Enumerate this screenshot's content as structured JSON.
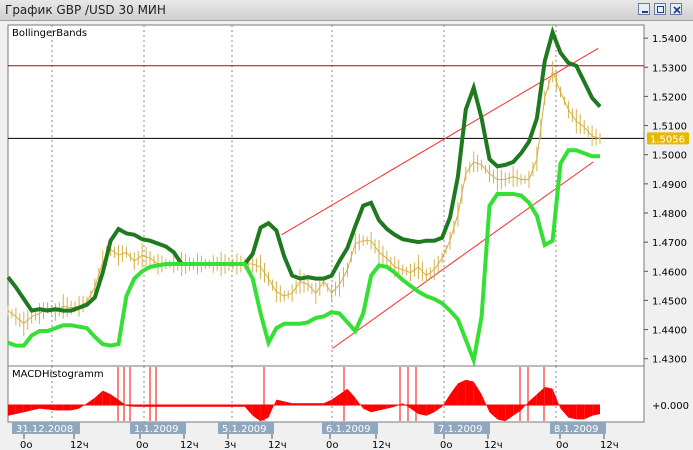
{
  "window": {
    "title": "График GBP /USD  30 МИН",
    "controls": [
      "minimize-icon",
      "restore-icon",
      "close-icon"
    ]
  },
  "colors": {
    "bg": "#ffffff",
    "price": "#d4b04a",
    "upper_band": "#1f7a1f",
    "lower_band": "#33e033",
    "channel": "#ff2a2a",
    "macd": "#ff0000",
    "hline_red": "#c00000",
    "hline_black": "#000000",
    "price_tag": "#e6b800",
    "date_tag": "#8fa8bf"
  },
  "main_panel": {
    "indicator_label": "BollingerBands",
    "price_axis_labels": [
      "1.5400",
      "1.5300",
      "1.5200",
      "1.5100",
      "1.5000",
      "1.4900",
      "1.4800",
      "1.4700",
      "1.4600",
      "1.4500",
      "1.4400",
      "1.4300"
    ],
    "current_price": "1.5056"
  },
  "sub_panel": {
    "indicator_label": "MACDHistogramm",
    "axis_label": "+0.000"
  },
  "time_axis": {
    "date_labels": [
      "31.12.2008",
      "1.1.2009",
      "5.1.2009",
      "6.1.2009",
      "7.1.2009",
      "8.1.2009"
    ],
    "hour_labels": [
      "0o",
      "12ч",
      "0o",
      "12ч",
      "3ч",
      "12ч",
      "0o",
      "12ч",
      "0o",
      "12ч",
      "0o",
      "12ч"
    ]
  },
  "chart_data": {
    "type": "line",
    "symbol": "GBP /USD",
    "timeframe": "30 МИН",
    "ylim": [
      1.4275,
      1.5445
    ],
    "current_price": 1.5056,
    "resistance_level": 1.5305,
    "support_level": 1.5056,
    "series": [
      {
        "name": "BollingerBands",
        "values": [
          1.458,
          1.4545,
          1.4505,
          1.4465,
          1.447,
          1.4465,
          1.447,
          1.4465,
          1.4465,
          1.4475,
          1.4485,
          1.451,
          1.4595,
          1.4705,
          1.4745,
          1.473,
          1.4725,
          1.471,
          1.4705,
          1.4695,
          1.4685,
          1.4665,
          1.4625,
          1.4625,
          1.4625,
          1.4625,
          1.4625,
          1.4625,
          1.4625,
          1.4625,
          1.4625,
          1.466,
          1.475,
          1.4765,
          1.474,
          1.465,
          1.4585,
          1.4575,
          1.458,
          1.4575,
          1.4575,
          1.4585,
          1.4635,
          1.468,
          1.4755,
          1.4825,
          1.4835,
          1.4775,
          1.4745,
          1.4725,
          1.471,
          1.4705,
          1.47,
          1.4705,
          1.4705,
          1.4715,
          1.4785,
          1.4925,
          1.5155,
          1.523,
          1.5125,
          1.4985,
          1.496,
          1.4965,
          1.4975,
          1.5005,
          1.5045,
          1.5125,
          1.532,
          1.542,
          1.535,
          1.5315,
          1.5305,
          1.525,
          1.5195,
          1.5165
        ]
      },
      {
        "name": "Lower band",
        "values": [
          1.4355,
          1.4345,
          1.4345,
          1.438,
          1.4395,
          1.4395,
          1.4405,
          1.4415,
          1.4415,
          1.441,
          1.4405,
          1.4375,
          1.435,
          1.4345,
          1.435,
          1.4515,
          1.4575,
          1.46,
          1.4615,
          1.462,
          1.4625,
          1.4625,
          1.4625,
          1.4625,
          1.4625,
          1.4625,
          1.4625,
          1.4625,
          1.4625,
          1.4625,
          1.4625,
          1.4575,
          1.4455,
          1.4355,
          1.4405,
          1.442,
          1.442,
          1.442,
          1.4425,
          1.444,
          1.4445,
          1.446,
          1.4455,
          1.4425,
          1.4395,
          1.4455,
          1.4585,
          1.462,
          1.4615,
          1.4595,
          1.457,
          1.455,
          1.453,
          1.4515,
          1.4505,
          1.449,
          1.4465,
          1.4435,
          1.4365,
          1.4295,
          1.4445,
          1.4825,
          1.4865,
          1.4865,
          1.4865,
          1.486,
          1.4835,
          1.479,
          1.469,
          1.4705,
          1.497,
          1.5015,
          1.5015,
          1.5005,
          1.4995,
          1.4995
        ]
      },
      {
        "name": "Price",
        "values": [
          1.4465,
          1.4445,
          1.442,
          1.4445,
          1.4455,
          1.4475,
          1.446,
          1.448,
          1.4475,
          1.448,
          1.4495,
          1.4545,
          1.463,
          1.4675,
          1.4655,
          1.4665,
          1.4635,
          1.4655,
          1.4645,
          1.4625,
          1.4625,
          1.4625,
          1.4625,
          1.4625,
          1.4625,
          1.4625,
          1.4625,
          1.4625,
          1.4625,
          1.4625,
          1.4625,
          1.4625,
          1.4615,
          1.4575,
          1.453,
          1.4515,
          1.4525,
          1.4565,
          1.4555,
          1.4525,
          1.4565,
          1.4525,
          1.4555,
          1.4605,
          1.4695,
          1.4705,
          1.4705,
          1.4665,
          1.4645,
          1.4615,
          1.4605,
          1.4595,
          1.4615,
          1.4585,
          1.4605,
          1.4645,
          1.4705,
          1.4795,
          1.4935,
          1.4975,
          1.4965,
          1.4935,
          1.4915,
          1.4915,
          1.4925,
          1.4915,
          1.4915,
          1.4985,
          1.5195,
          1.5285,
          1.5215,
          1.5155,
          1.5115,
          1.5095,
          1.5065,
          1.5055
        ]
      }
    ],
    "channel_lines": [
      {
        "from": [
          0.43,
          1.4725
        ],
        "to": [
          0.928,
          1.5365
        ]
      },
      {
        "from": [
          0.51,
          1.4335
        ],
        "to": [
          0.92,
          1.4975
        ]
      }
    ],
    "macd": {
      "name": "MACDHistogramm",
      "values": [
        -0.6,
        -0.5,
        -0.4,
        -0.3,
        -0.2,
        -0.25,
        -0.3,
        -0.3,
        -0.3,
        -0.2,
        0.1,
        0.4,
        0.8,
        0.6,
        0.3,
        -0.05,
        -0.1,
        -0.1,
        -0.1,
        -0.1,
        -0.1,
        -0.1,
        -0.1,
        -0.1,
        -0.1,
        -0.1,
        -0.1,
        -0.1,
        -0.1,
        -0.1,
        -0.1,
        -0.6,
        -0.9,
        -0.7,
        0.3,
        0.2,
        0.1,
        0.1,
        0.1,
        0.1,
        0.1,
        0.3,
        0.6,
        0.9,
        0.4,
        -0.2,
        -0.4,
        -0.3,
        -0.2,
        -0.1,
        0.1,
        -0.2,
        -0.5,
        -0.6,
        -0.4,
        -0.1,
        0.6,
        1.2,
        1.4,
        1.3,
        0.6,
        -0.4,
        -0.8,
        -0.9,
        -0.6,
        -0.3,
        0.2,
        0.6,
        1.0,
        0.9,
        -0.2,
        -0.7,
        -0.8,
        -0.8,
        -0.6,
        -0.5
      ]
    }
  }
}
